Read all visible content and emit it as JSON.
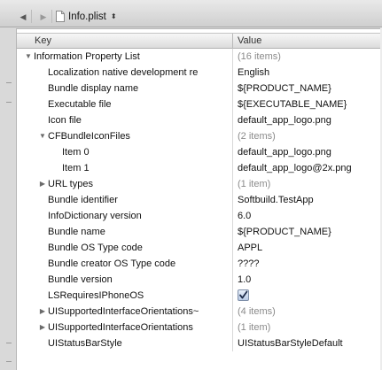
{
  "jumpbar": {
    "back_icon": "left-arrow",
    "forward_icon": "right-arrow",
    "file_icon": "document-icon",
    "file_name": "Info.plist",
    "menu_arrows": "⬍"
  },
  "table": {
    "key_header": "Key",
    "value_header": "Value",
    "rows": [
      {
        "key": "Information Property List",
        "value": "(16 items)",
        "muted": true,
        "expander": "open"
      },
      {
        "key": "Localization native development re",
        "value": "English"
      },
      {
        "key": "Bundle display name",
        "value": "${PRODUCT_NAME}"
      },
      {
        "key": "Executable file",
        "value": "${EXECUTABLE_NAME}"
      },
      {
        "key": "Icon file",
        "value": "default_app_logo.png"
      },
      {
        "key": "CFBundleIconFiles",
        "value": "(2 items)",
        "muted": true,
        "expander": "open"
      },
      {
        "key": "Item 0",
        "value": "default_app_logo.png"
      },
      {
        "key": "Item 1",
        "value": "default_app_logo@2x.png"
      },
      {
        "key": "URL types",
        "value": "(1 item)",
        "muted": true,
        "expander": "closed"
      },
      {
        "key": "Bundle identifier",
        "value": "Softbuild.TestApp"
      },
      {
        "key": "InfoDictionary version",
        "value": "6.0"
      },
      {
        "key": "Bundle name",
        "value": "${PRODUCT_NAME}"
      },
      {
        "key": "Bundle OS Type code",
        "value": "APPL"
      },
      {
        "key": "Bundle creator OS Type code",
        "value": "????"
      },
      {
        "key": "Bundle version",
        "value": "1.0"
      },
      {
        "key": "LSRequiresIPhoneOS",
        "value": "",
        "checkbox": true,
        "checked": true
      },
      {
        "key": "UISupportedInterfaceOrientations~",
        "value": "(4 items)",
        "muted": true,
        "expander": "closed"
      },
      {
        "key": "UISupportedInterfaceOrientations",
        "value": "(1 item)",
        "muted": true,
        "expander": "closed"
      },
      {
        "key": "UIStatusBarStyle",
        "value": "UIStatusBarStyleDefault"
      }
    ]
  }
}
